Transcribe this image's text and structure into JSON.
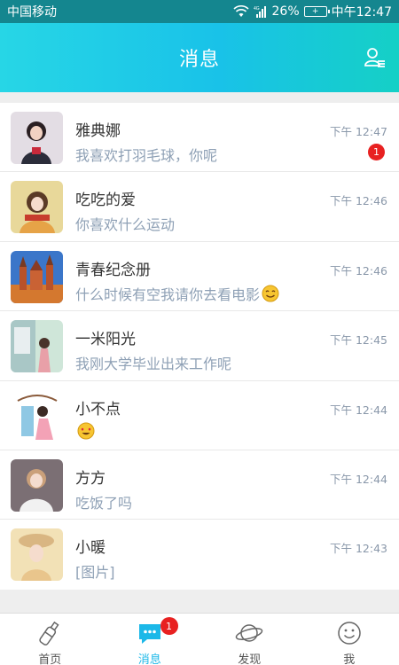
{
  "status_bar": {
    "carrier": "中国移动",
    "network": "4G",
    "battery": "26%",
    "time": "中午12:47"
  },
  "header": {
    "title": "消息",
    "right_icon": "contacts-icon"
  },
  "colors": {
    "accent": "#1cb8e8",
    "badge": "#e82121",
    "status_bar": "#14868f"
  },
  "conversations": [
    {
      "name": "雅典娜",
      "message": "我喜欢打羽毛球，你呢",
      "time": "下午 12:47",
      "unread": "1",
      "avatar": "woman-black-hair-portrait"
    },
    {
      "name": "吃吃的爱",
      "message": "你喜欢什么运动",
      "time": "下午 12:46",
      "unread": null,
      "avatar": "girl-with-scarf-portrait"
    },
    {
      "name": "青春纪念册",
      "message": "什么时候有空我请你去看电影",
      "time": "下午 12:46",
      "unread": null,
      "avatar": "castle-scenery",
      "message_emoji": "smile-emoji"
    },
    {
      "name": "一米阳光",
      "message": "我刚大学毕业出来工作呢",
      "time": "下午 12:45",
      "unread": null,
      "avatar": "anime-girl-train",
      "emoji_only": null
    },
    {
      "name": "小不点",
      "message": "",
      "time": "下午 12:44",
      "unread": null,
      "avatar": "anime-girl-umbrella",
      "message_emoji": "heart-eyes-emoji"
    },
    {
      "name": "方方",
      "message": "吃饭了吗",
      "time": "下午 12:44",
      "unread": null,
      "avatar": "woman-short-hair-portrait"
    },
    {
      "name": "小暖",
      "message": "[图片]",
      "time": "下午 12:43",
      "unread": null,
      "avatar": "girl-with-hat-portrait"
    }
  ],
  "tabs": [
    {
      "label": "首页",
      "icon": "bottle-icon",
      "active": false
    },
    {
      "label": "消息",
      "icon": "chat-bubble-icon",
      "active": true,
      "badge": "1"
    },
    {
      "label": "发现",
      "icon": "planet-icon",
      "active": false
    },
    {
      "label": "我",
      "icon": "smiley-face-icon",
      "active": false
    }
  ]
}
